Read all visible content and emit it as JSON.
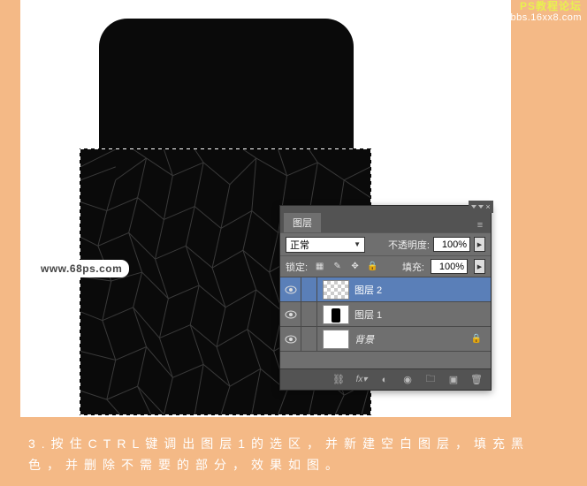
{
  "watermarks": {
    "site": "www.68ps.com",
    "forum_title": "PS教程论坛",
    "forum_url": "bbs.16xx8.com"
  },
  "instruction": "3.按住CTRL键调出图层1的选区，并新建空白图层，填充黑色，并删除不需要的部分，效果如图。",
  "panel": {
    "tab": "图层",
    "blend_mode": "正常",
    "opacity_label": "不透明度:",
    "opacity_value": "100%",
    "lock_label": "锁定:",
    "fill_label": "填充:",
    "fill_value": "100%",
    "layers": [
      {
        "name": "图层 2",
        "selected": true,
        "thumb": "transparent"
      },
      {
        "name": "图层 1",
        "selected": false,
        "thumb": "mini"
      },
      {
        "name": "背景",
        "selected": false,
        "thumb": "white",
        "locked": true,
        "italic": true
      }
    ],
    "foot_icons": [
      "link-icon",
      "fx-icon",
      "mask-icon",
      "adjust-icon",
      "group-icon",
      "new-icon",
      "trash-icon"
    ]
  }
}
